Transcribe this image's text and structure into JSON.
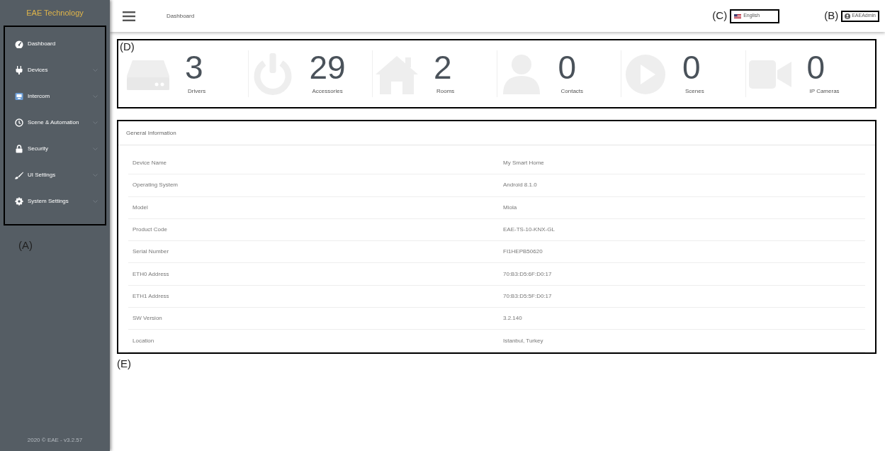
{
  "sidebar": {
    "brand": "EAE Technology",
    "items": [
      {
        "label": "Dashboard",
        "expandable": false
      },
      {
        "label": "Devices",
        "expandable": true
      },
      {
        "label": "Intercom",
        "expandable": true
      },
      {
        "label": "Scene & Automation",
        "expandable": true
      },
      {
        "label": "Security",
        "expandable": true
      },
      {
        "label": "UI Settings",
        "expandable": true
      },
      {
        "label": "System Settings",
        "expandable": true
      }
    ],
    "footer": "2020 © EAE - v3.2.57"
  },
  "header": {
    "breadcrumb": "Dashboard",
    "language": "English",
    "user": "EAEAdmin"
  },
  "stats": [
    {
      "value": "3",
      "label": "Drivers"
    },
    {
      "value": "29",
      "label": "Accessories"
    },
    {
      "value": "2",
      "label": "Rooms"
    },
    {
      "value": "0",
      "label": "Contacts"
    },
    {
      "value": "0",
      "label": "Scenes"
    },
    {
      "value": "0",
      "label": "IP Cameras"
    }
  ],
  "general_information": {
    "title": "General Information",
    "rows": [
      {
        "label": "Device Name",
        "value": "My Smart Home"
      },
      {
        "label": "Operating System",
        "value": "Android 8.1.0"
      },
      {
        "label": "Model",
        "value": "Miola"
      },
      {
        "label": "Product Code",
        "value": "EAE-TS-10-KNX-GL"
      },
      {
        "label": "Serial Number",
        "value": "FI1HEPB50620"
      },
      {
        "label": "ETH0 Address",
        "value": "70:B3:D5:6F:D0:17"
      },
      {
        "label": "ETH1 Address",
        "value": "70:B3:D5:5F:D0:17"
      },
      {
        "label": "SW Version",
        "value": "3.2.140"
      },
      {
        "label": "Location",
        "value": "Istanbul, Turkey"
      }
    ]
  },
  "annotations": {
    "sidebar": "(A)",
    "user": "(B)",
    "language": "(C)",
    "stats": "(D)",
    "info": "(E)"
  }
}
